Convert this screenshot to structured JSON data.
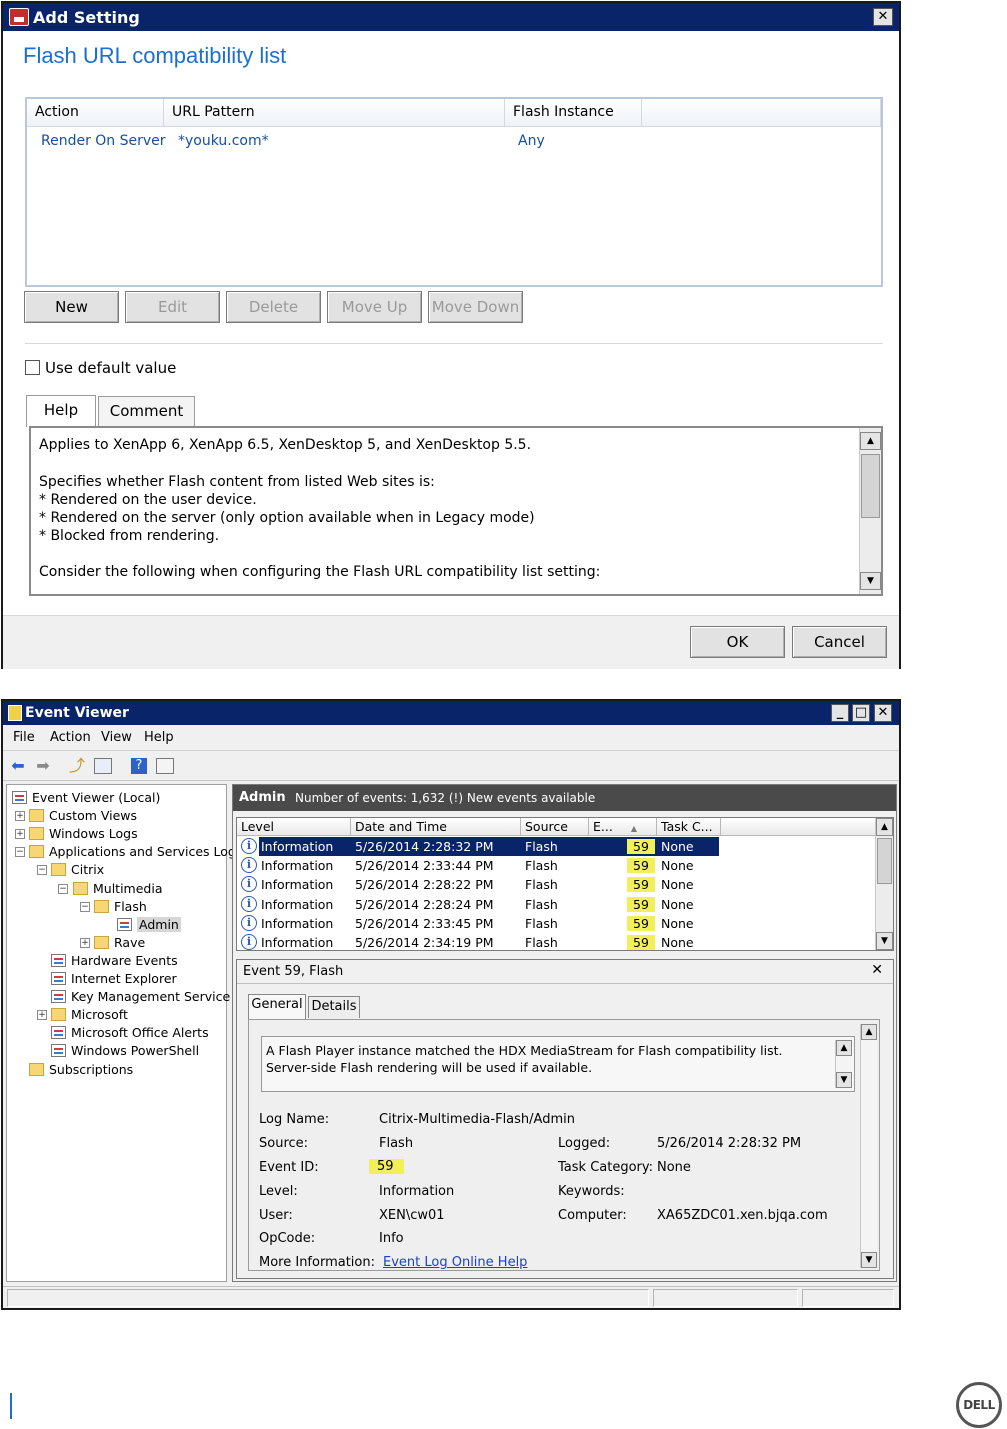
{
  "add_setting": {
    "title": "Add Setting",
    "close_glyph": "✕",
    "heading": "Flash URL compatibility list",
    "columns": [
      "Action",
      "URL Pattern",
      "Flash Instance"
    ],
    "rows": [
      {
        "action": "Render On Server",
        "url_pattern": "*youku.com*",
        "flash_instance": "Any"
      }
    ],
    "buttons": {
      "new": "New",
      "edit": "Edit",
      "delete": "Delete",
      "move_up": "Move Up",
      "move_down": "Move Down"
    },
    "use_default_label": "Use default value",
    "tabs": {
      "help": "Help",
      "comment": "Comment"
    },
    "help_lines": [
      "Applies to XenApp 6, XenApp 6.5, XenDesktop 5, and XenDesktop 5.5.",
      "",
      "Specifies whether Flash content from listed Web sites is:",
      "* Rendered on the user device.",
      "* Rendered on the server (only option available when in Legacy mode)",
      "* Blocked from rendering.",
      "",
      "Consider the following when configuring the Flash URL compatibility list setting:"
    ],
    "ok_label": "OK",
    "cancel_label": "Cancel"
  },
  "event_viewer": {
    "title": "Event Viewer",
    "window_buttons": [
      "_",
      "□",
      "✕"
    ],
    "menu": [
      "File",
      "Action",
      "View",
      "Help"
    ],
    "tree": [
      {
        "label": "Event Viewer (Local)",
        "level": 0,
        "expander": ""
      },
      {
        "label": "Custom Views",
        "level": 1,
        "expander": "+"
      },
      {
        "label": "Windows Logs",
        "level": 1,
        "expander": "+"
      },
      {
        "label": "Applications and Services Logs",
        "level": 1,
        "expander": "−"
      },
      {
        "label": "Citrix",
        "level": 2,
        "expander": "−"
      },
      {
        "label": "Multimedia",
        "level": 3,
        "expander": "−"
      },
      {
        "label": "Flash",
        "level": 4,
        "expander": "−"
      },
      {
        "label": "Admin",
        "level": 5,
        "expander": ""
      },
      {
        "label": "Rave",
        "level": 4,
        "expander": "+"
      },
      {
        "label": "Hardware Events",
        "level": 2,
        "expander": ""
      },
      {
        "label": "Internet Explorer",
        "level": 2,
        "expander": ""
      },
      {
        "label": "Key Management Service",
        "level": 2,
        "expander": ""
      },
      {
        "label": "Microsoft",
        "level": 2,
        "expander": "+"
      },
      {
        "label": "Microsoft Office Alerts",
        "level": 2,
        "expander": ""
      },
      {
        "label": "Windows PowerShell",
        "level": 2,
        "expander": ""
      },
      {
        "label": "Subscriptions",
        "level": 1,
        "expander": ""
      }
    ],
    "log_name_bar": "Admin",
    "events_count_text": "Number of events: 1,632 (!) New events available",
    "event_columns": [
      "Level",
      "Date and Time",
      "Source",
      "E...",
      "Task C..."
    ],
    "events": [
      {
        "level": "Information",
        "datetime": "5/26/2014 2:28:32 PM",
        "source": "Flash",
        "event_id": "59",
        "task": "None"
      },
      {
        "level": "Information",
        "datetime": "5/26/2014 2:33:44 PM",
        "source": "Flash",
        "event_id": "59",
        "task": "None"
      },
      {
        "level": "Information",
        "datetime": "5/26/2014 2:28:22 PM",
        "source": "Flash",
        "event_id": "59",
        "task": "None"
      },
      {
        "level": "Information",
        "datetime": "5/26/2014 2:28:24 PM",
        "source": "Flash",
        "event_id": "59",
        "task": "None"
      },
      {
        "level": "Information",
        "datetime": "5/26/2014 2:33:45 PM",
        "source": "Flash",
        "event_id": "59",
        "task": "None"
      },
      {
        "level": "Information",
        "datetime": "5/26/2014 2:34:19 PM",
        "source": "Flash",
        "event_id": "59",
        "task": "None"
      }
    ],
    "detail": {
      "header": "Event 59, Flash",
      "close_glyph": "✕",
      "tabs": {
        "general": "General",
        "details": "Details"
      },
      "description": "A Flash Player instance matched the HDX MediaStream for Flash compatibility list.  Server-side Flash rendering will be used if available.",
      "labels": {
        "log_name": "Log Name:",
        "source": "Source:",
        "event_id": "Event ID:",
        "level": "Level:",
        "user": "User:",
        "opcode": "OpCode:",
        "more_info": "More Information:",
        "logged": "Logged:",
        "task_category": "Task Category:",
        "keywords": "Keywords:",
        "computer": "Computer:"
      },
      "values": {
        "log_name": "Citrix-Multimedia-Flash/Admin",
        "source": "Flash",
        "event_id": "59",
        "level": "Information",
        "user": "XEN\\cw01",
        "opcode": "Info",
        "more_info": "Event Log Online Help",
        "logged": "5/26/2014 2:28:32 PM",
        "task_category": "None",
        "keywords": "",
        "computer": "XA65ZDC01.xen.bjqa.com"
      }
    }
  },
  "footer": {
    "logo": "DELL"
  },
  "colors": {
    "title_bar": "#0a246a",
    "heading": "#1c6fd0",
    "highlight": "#f1f05a",
    "link": "#1a3fd0"
  },
  "icons": [
    "close-icon",
    "setting-window-icon",
    "event-viewer-icon",
    "back-arrow-icon",
    "forward-arrow-icon",
    "up-folder-icon",
    "console-tree-icon",
    "help-icon",
    "properties-icon",
    "information-icon",
    "folder-icon",
    "log-icon",
    "sort-asc-icon"
  ]
}
